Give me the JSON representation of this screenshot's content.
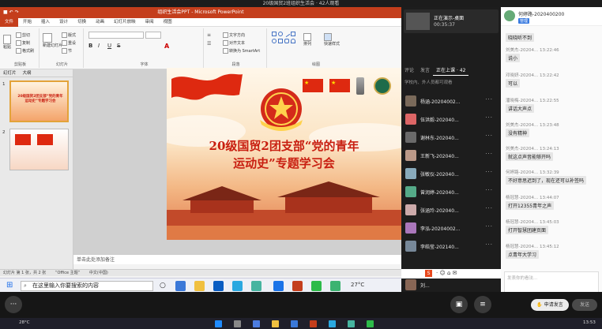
{
  "meeting": {
    "top_title": "20级国贸2班组织生活会 · 42人观看",
    "more_label": "···",
    "apply_speak": "申请发言",
    "send": "发送"
  },
  "ppt": {
    "window_title": "组织生活会PPT - Microsoft PowerPoint",
    "tabs": [
      "文件",
      "开始",
      "插入",
      "设计",
      "切换",
      "动画",
      "幻灯片放映",
      "审阅",
      "视图"
    ],
    "groups": {
      "clipboard": {
        "label": "剪贴板",
        "items": [
          "剪切",
          "复制",
          "格式刷",
          "粘贴"
        ]
      },
      "slides": {
        "label": "幻灯片",
        "items": [
          "新建幻灯片",
          "版式",
          "重设",
          "节"
        ]
      },
      "font": {
        "label": "字体",
        "bold": "B",
        "italic": "I",
        "underline": "U",
        "strike": "S",
        "font_name": "",
        "font_size": ""
      },
      "paragraph": {
        "label": "段落",
        "items": [
          "文字方向",
          "对齐文本",
          "转换为 SmartArt"
        ]
      },
      "drawing": {
        "label": "绘图",
        "items": [
          "排列",
          "快速样式"
        ]
      }
    },
    "panel_tabs": [
      "幻灯片",
      "大纲"
    ],
    "slide_numbers": [
      "1",
      "2"
    ],
    "slide_title_line1": "20级国贸2团支部“党的青年",
    "slide_title_line2": "运动史”专题学习会",
    "thumb1_text": "20级国贸2团支部“党的青年运动史”专题学习会",
    "notes_placeholder": "单击此处添加备注",
    "status": [
      "幻灯片 第 1 张，共 2 张",
      "“Office 主题”",
      "中文(中国)"
    ]
  },
  "windows": {
    "search_placeholder": "在这里输入你要搜索的内容",
    "tray_temp": "27°C"
  },
  "host_taskbar": {
    "weather": "28°C",
    "time": "13:53"
  },
  "participants": {
    "share_label": "正在演示-桌面",
    "share_time": "00:35:37",
    "tabs": [
      "评论",
      "发言",
      "正在上课 · 42"
    ],
    "group_label": "学校内、外人员都可观看",
    "list": [
      {
        "name": "杨涵-20204002..."
      },
      {
        "name": "伍洪毅-202040..."
      },
      {
        "name": "谢林东-202040..."
      },
      {
        "name": "王新飞-202040..."
      },
      {
        "name": "张敏仪-202040..."
      },
      {
        "name": "曾润婷-202040..."
      },
      {
        "name": "张涵玲-202040..."
      },
      {
        "name": "李泓-20204002..."
      },
      {
        "name": "李皓莹-202140..."
      },
      {
        "name": "刘..."
      }
    ],
    "more": "···"
  },
  "chat": {
    "header_name": "何婷路-2020400200",
    "header_badge": "管理",
    "messages": [
      {
        "who": "",
        "time": "",
        "text": "晓晓听不到"
      },
      {
        "who": "刘美杰-20204...",
        "time": "13:22:46",
        "text": "说小"
      },
      {
        "who": "邓晓妍-20204...",
        "time": "13:22:42",
        "text": "可以"
      },
      {
        "who": "潘晓梅-20204...",
        "time": "13:22:55",
        "text": "讲话大声点"
      },
      {
        "who": "刘美杰-20204...",
        "time": "13:23:48",
        "text": "没有精神"
      },
      {
        "who": "刘美杰-20204...",
        "time": "13:24:13",
        "text": "就这点声音能够开吗"
      },
      {
        "who": "何婷路-20204...",
        "time": "13:32:39",
        "text": "不好意思迟到了，现在还可以补签吗"
      },
      {
        "who": "杨冠慧-20204...",
        "time": "13:44:07",
        "text": "打开12355青年之声"
      },
      {
        "who": "杨冠慧-20204...",
        "time": "13:45:03",
        "text": "打开智慧团建页面"
      },
      {
        "who": "杨冠慧-20204...",
        "time": "13:45:12",
        "text": "点青年大学习"
      }
    ],
    "input_placeholder": "发表你的看法..."
  },
  "colors": {
    "ppt_accent": "#c43e1c",
    "slide_title": "#c81e10",
    "flag_red": "#de2910",
    "star_yellow": "#ffde00"
  }
}
